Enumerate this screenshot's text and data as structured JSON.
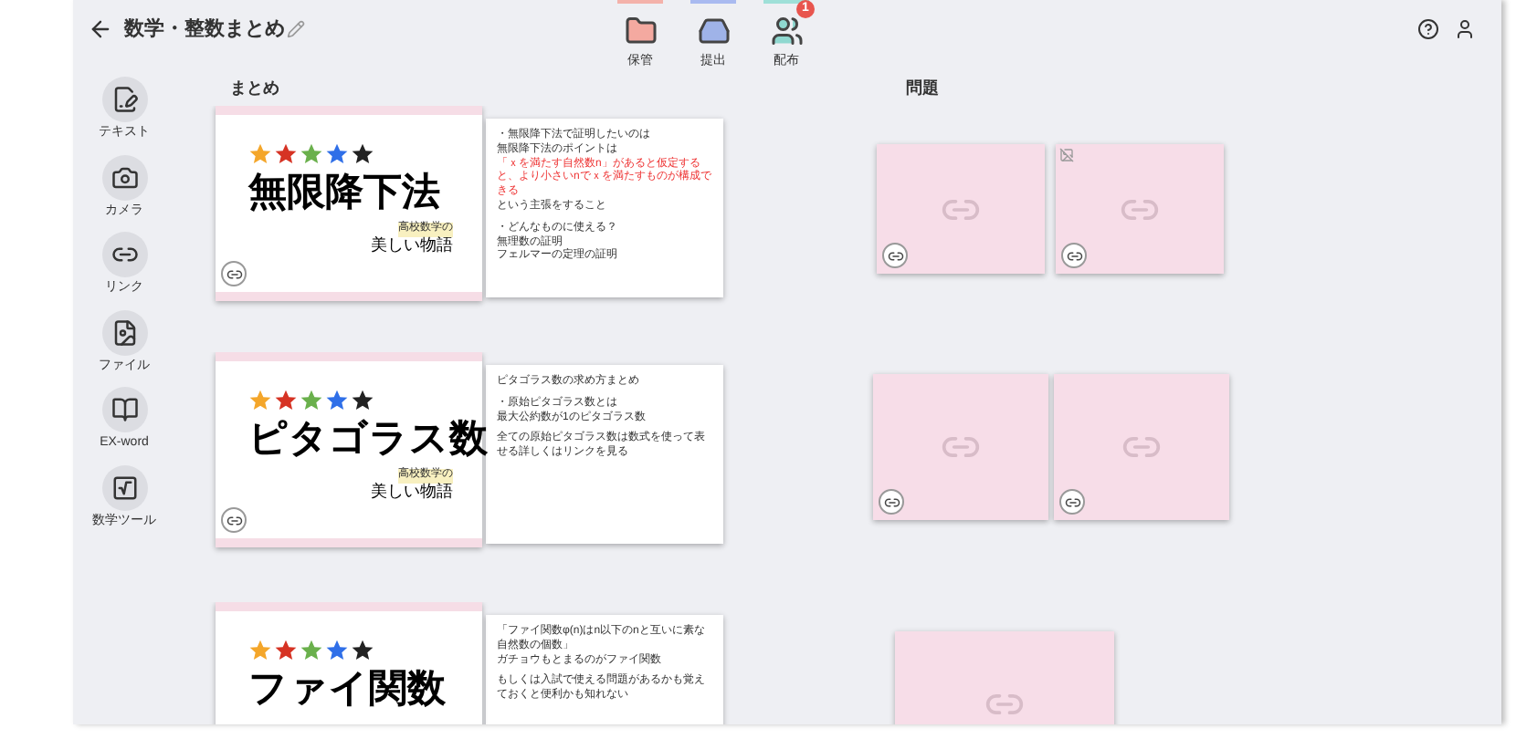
{
  "header": {
    "title": "数学・整数まとめ",
    "actions": [
      {
        "label": "保管",
        "kind": "folder"
      },
      {
        "label": "提出",
        "kind": "tray"
      },
      {
        "label": "配布",
        "kind": "people",
        "badge": "1"
      }
    ]
  },
  "sidebar": [
    {
      "label": "テキスト",
      "kind": "text"
    },
    {
      "label": "カメラ",
      "kind": "camera"
    },
    {
      "label": "リンク",
      "kind": "link"
    },
    {
      "label": "ファイル",
      "kind": "file"
    },
    {
      "label": "EX-word",
      "kind": "dictionary"
    },
    {
      "label": "数学ツール",
      "kind": "math"
    }
  ],
  "sections": {
    "summary": "まとめ",
    "problems": "問題"
  },
  "rows": [
    {
      "slide": {
        "title": "無限降下法",
        "tag": "高校数学の",
        "subtitle": "美しい物語"
      },
      "notes": [
        {
          "text": "・無限降下法で証明したいのは",
          "kind": "plain"
        },
        {
          "text": "無限降下法のポイントは",
          "kind": "plain"
        },
        {
          "text": "「ｘを満たす自然数n」があると仮定すると、より小さいnでｘを満たすものが構成できる",
          "kind": "red"
        },
        {
          "text": "という主張をすること",
          "kind": "plain"
        },
        {
          "text": "・どんなものに使える？",
          "kind": "gap"
        },
        {
          "text": "無理数の証明",
          "kind": "plain"
        },
        {
          "text": "フェルマーの定理の証明",
          "kind": "plain"
        }
      ],
      "problems": [
        {
          "kind": "link"
        },
        {
          "kind": "image"
        }
      ]
    },
    {
      "slide": {
        "title": "ピタゴラス数",
        "tag": "高校数学の",
        "subtitle": "美しい物語"
      },
      "notes": [
        {
          "text": "ピタゴラス数の求め方まとめ",
          "kind": "plain"
        },
        {
          "text": "・原始ピタゴラス数とは",
          "kind": "gap"
        },
        {
          "text": "最大公約数が1のピタゴラス数",
          "kind": "plain"
        },
        {
          "text": "全ての原始ピタゴラス数は数式を使って表せる詳しくはリンクを見る",
          "kind": "gap"
        }
      ],
      "problems": [
        {
          "kind": "link"
        },
        {
          "kind": "link"
        }
      ]
    },
    {
      "slide": {
        "title": "ファイ関数"
      },
      "notes": [
        {
          "text": "「ファイ関数φ(n)はn以下のnと互いに素な自然数の個数」",
          "kind": "plain"
        },
        {
          "text": "ガチョウもとまるのがファイ関数",
          "kind": "plain"
        },
        {
          "text": "もしくは入試で使える問題があるかも覚えておくと便利かも知れない",
          "kind": "gap"
        }
      ],
      "problems": [
        {
          "kind": "link"
        }
      ]
    }
  ]
}
